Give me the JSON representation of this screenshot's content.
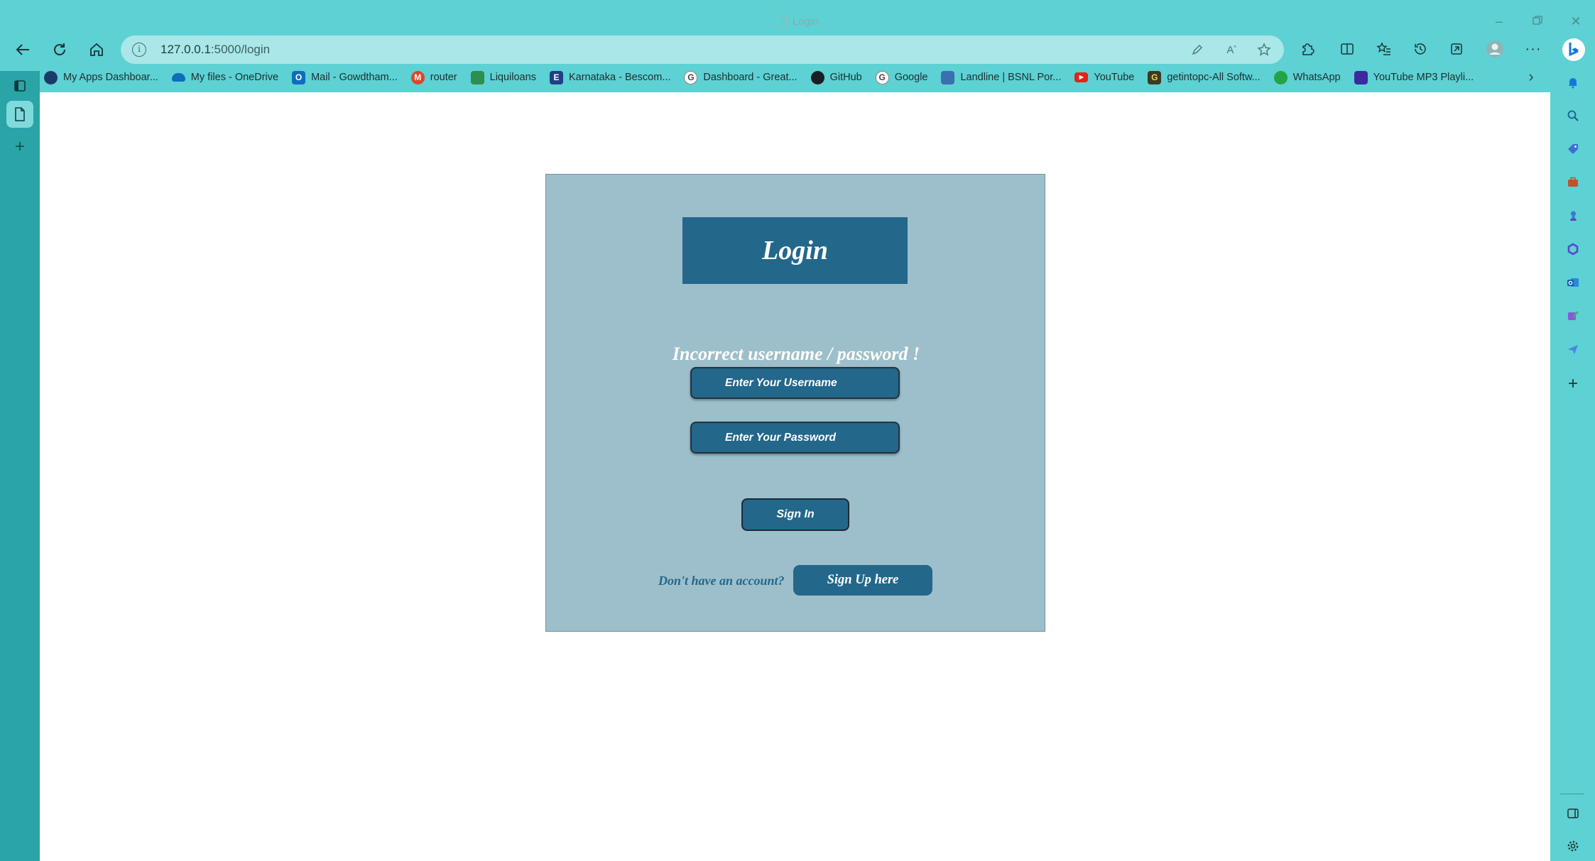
{
  "browser": {
    "tab_title": "Login",
    "address": {
      "host": "127.0.0.1",
      "path": ":5000/login"
    },
    "bookmarks": [
      {
        "label": "My Apps Dashboar...",
        "icon": "my-apps-icon",
        "color": "#1b3a6b"
      },
      {
        "label": "My files - OneDrive",
        "icon": "onedrive-icon",
        "color": "#0f6cbd"
      },
      {
        "label": "Mail - Gowdtham...",
        "icon": "outlook-icon",
        "color": "#0f6cbd"
      },
      {
        "label": "router",
        "icon": "router-icon",
        "color": "#d9472b"
      },
      {
        "label": "Liquiloans",
        "icon": "liquiloans-icon",
        "color": "#2d8f4e"
      },
      {
        "label": "Karnataka - Bescom...",
        "icon": "bescom-icon",
        "color": "#1f3f86"
      },
      {
        "label": "Dashboard - Great...",
        "icon": "google-icon",
        "color": "#ffffff"
      },
      {
        "label": "GitHub",
        "icon": "github-icon",
        "color": "#1b1f23"
      },
      {
        "label": "Google",
        "icon": "google-icon",
        "color": "#ffffff"
      },
      {
        "label": "Landline | BSNL Por...",
        "icon": "bsnl-icon",
        "color": "#3a6fb0"
      },
      {
        "label": "YouTube",
        "icon": "youtube-icon",
        "color": "#e62117"
      },
      {
        "label": "getintopc-All Softw...",
        "icon": "getintopc-icon",
        "color": "#3b3b1f"
      },
      {
        "label": "WhatsApp",
        "icon": "whatsapp-icon",
        "color": "#25a244"
      },
      {
        "label": "YouTube MP3 Playli...",
        "icon": "mp3-playlist-icon",
        "color": "#3c2a9e"
      }
    ]
  },
  "login": {
    "heading": "Login",
    "error_message": "Incorrect username / password !",
    "username_placeholder": "Enter Your Username",
    "password_placeholder": "Enter Your Password",
    "signin_label": "Sign In",
    "no_account_text": "Don't have an account?",
    "signup_label": "Sign Up here"
  },
  "colors": {
    "browser_frame": "#5dd1d3",
    "card_background": "#9dbfcb",
    "primary": "#23678b",
    "page_background": "#ffffff"
  }
}
